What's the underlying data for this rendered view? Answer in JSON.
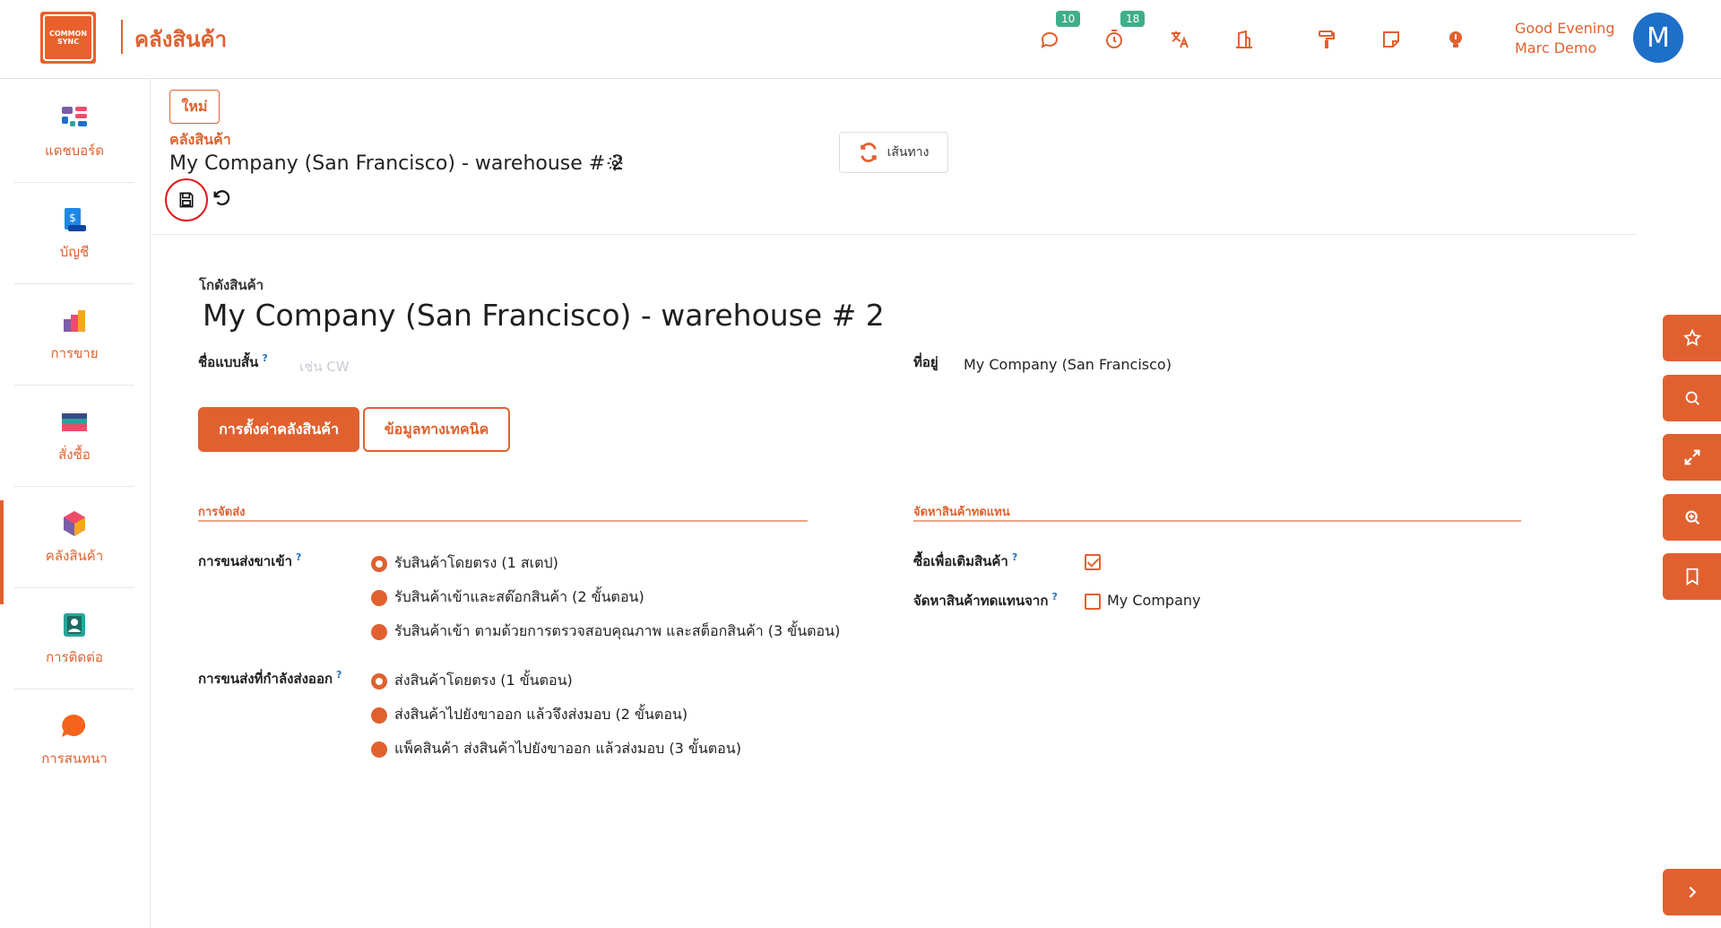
{
  "app": {
    "logo_line1": "COMMON",
    "logo_line2": "SYNC",
    "title": "คลังสินค้า"
  },
  "topbar": {
    "messages_badge": "10",
    "activities_badge": "18",
    "greeting_line1": "Good Evening",
    "greeting_line2": "Marc Demo",
    "avatar_letter": "M"
  },
  "sidebar": {
    "items": [
      {
        "label": "แดชบอร์ด",
        "icon": "dashboard-icon"
      },
      {
        "label": "บัญชี",
        "icon": "accounting-icon"
      },
      {
        "label": "การขาย",
        "icon": "sales-icon"
      },
      {
        "label": "สั่งซื้อ",
        "icon": "purchase-icon"
      },
      {
        "label": "คลังสินค้า",
        "icon": "inventory-icon",
        "active": true
      },
      {
        "label": "การติดต่อ",
        "icon": "contacts-icon"
      },
      {
        "label": "การสนทนา",
        "icon": "discuss-icon"
      }
    ]
  },
  "header": {
    "new_label": "ใหม่",
    "breadcrumb": "คลังสินค้า",
    "record_title": "My Company (San Francisco) - warehouse # 2",
    "route_label": "เส้นทาง"
  },
  "form": {
    "warehouse_label": "โกดังสินค้า",
    "warehouse_name": "My Company (San Francisco) - warehouse # 2",
    "short_name_label": "ชื่อแบบสั้น",
    "short_name_placeholder": "เช่น CW",
    "address_label": "ที่อยู่",
    "address_value": "My Company (San Francisco)",
    "tabs": {
      "config": "การตั้งค่าคลังสินค้า",
      "technical": "ข้อมูลทางเทคนิค"
    },
    "shipments_title": "การจัดส่ง",
    "incoming_label": "การขนส่งขาเข้า",
    "incoming_options": [
      "รับสินค้าโดยตรง (1 สเตป)",
      "รับสินค้าเข้าและสต๊อกสินค้า (2 ขั้นตอน)",
      "รับสินค้าเข้า ตามด้วยการตรวจสอบคุณภาพ และสต็อกสินค้า (3 ขั้นตอน)"
    ],
    "incoming_selected": 0,
    "outgoing_label": "การขนส่งที่กำลังส่งออก",
    "outgoing_options": [
      "ส่งสินค้าโดยตรง (1 ขั้นตอน)",
      "ส่งสินค้าไปยังขาออก แล้วจึงส่งมอบ (2 ขั้นตอน)",
      "แพ็คสินค้า ส่งสินค้าไปยังขาออก แล้วส่งมอบ (3 ขั้นตอน)"
    ],
    "outgoing_selected": 0,
    "resupply_title": "จัดหาสินค้าทดแทน",
    "buy_label": "ซื้อเพื่อเติมสินค้า",
    "buy_checked": true,
    "resupply_from_label": "จัดหาสินค้าทดแทนจาก",
    "resupply_from_value": "My Company",
    "resupply_from_checked": false
  },
  "colors": {
    "accent": "#e0612f",
    "badge": "#3fae8a",
    "avatar": "#1e6fc8",
    "save_highlight": "#e21b1b"
  }
}
